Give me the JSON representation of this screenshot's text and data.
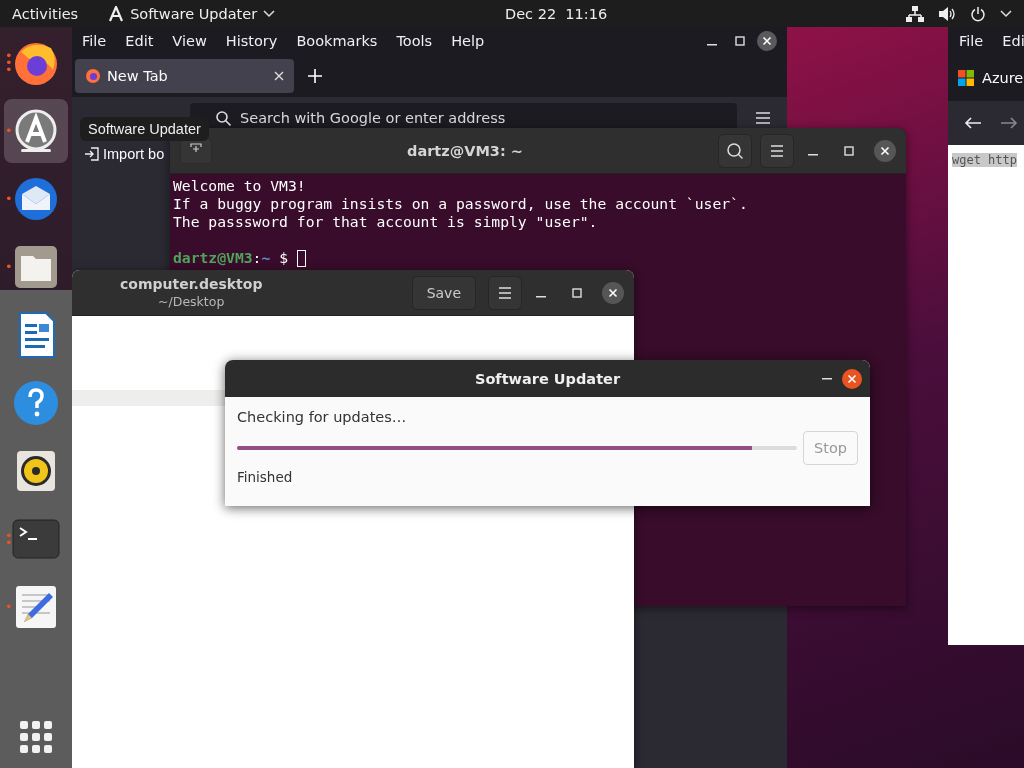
{
  "top_bar": {
    "activities": "Activities",
    "app_menu": "Software Updater",
    "clock": "Dec 22  11:16"
  },
  "dock": {
    "items": [
      {
        "kind": "firefox",
        "selected": false,
        "indicator": "•••"
      },
      {
        "kind": "updater",
        "selected": true,
        "indicator": "•"
      },
      {
        "kind": "mail",
        "selected": false,
        "indicator": "•"
      },
      {
        "kind": "files",
        "selected": false,
        "indicator": "•"
      },
      {
        "kind": "writer",
        "selected": false
      },
      {
        "kind": "help",
        "selected": false
      },
      {
        "kind": "music",
        "selected": false
      },
      {
        "kind": "terminal",
        "selected": false,
        "indicator": "••"
      },
      {
        "kind": "editor",
        "selected": false,
        "indicator": "•"
      }
    ]
  },
  "tooltip": "Software Updater",
  "browser": {
    "menu": [
      "File",
      "Edit",
      "View",
      "History",
      "Bookmarks",
      "Tools",
      "Help"
    ],
    "tab": {
      "title": "New Tab",
      "selected": true
    },
    "address": {
      "placeholder": "Search with Google or enter address"
    },
    "bookmark": "Import bo"
  },
  "terminal": {
    "title": "dartz@VM3: ~",
    "lines": [
      "Welcome to VM3!",
      "If a buggy program insists on a password, use the account `user`.",
      "The passsword for that account is simply \"user\"."
    ],
    "prompt": {
      "user_host": "dartz@VM3",
      "separator": ":",
      "path": "~",
      "symbol": "$"
    }
  },
  "editor": {
    "title": "computer.desktop",
    "subtitle": "~/Desktop",
    "save": "Save"
  },
  "dialog": {
    "title": "Software Updater",
    "status": "Checking for updates…",
    "progress": {
      "level": 0.92
    },
    "stop": {
      "label": "Stop",
      "disabled": true
    },
    "detail": "Finished"
  },
  "browser_2": {
    "menu": [
      "File",
      "Edi"
    ],
    "tab": {
      "title": "Azure"
    },
    "content": "wget http"
  }
}
